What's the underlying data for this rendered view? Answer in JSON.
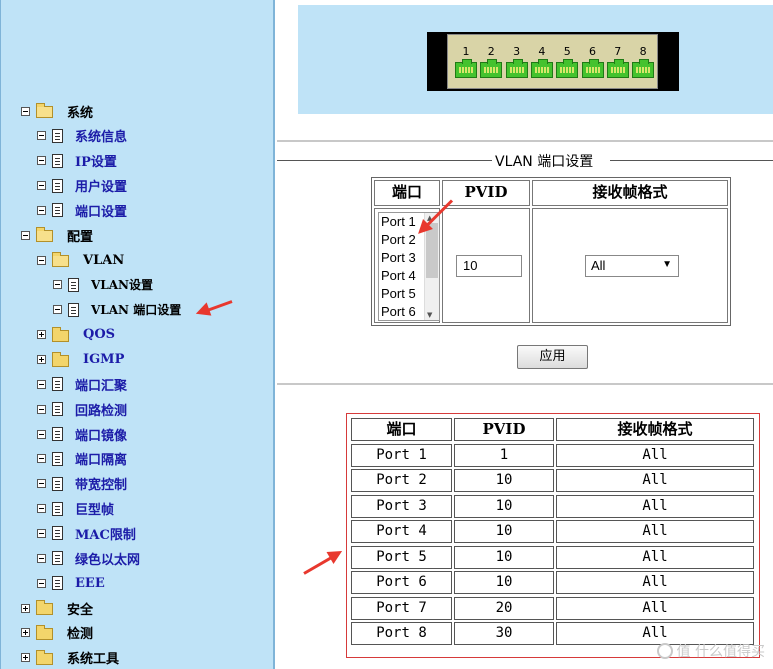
{
  "sidebar": {
    "items": [
      {
        "label": "系统",
        "icon": "folder-open-icon",
        "toggle": "minus"
      },
      {
        "label": "系统信息",
        "icon": "page-icon",
        "toggle": "minus"
      },
      {
        "label": "IP设置",
        "icon": "page-icon",
        "toggle": "minus"
      },
      {
        "label": "用户设置",
        "icon": "page-icon",
        "toggle": "minus"
      },
      {
        "label": "端口设置",
        "icon": "page-icon",
        "toggle": "minus"
      },
      {
        "label": "配置",
        "icon": "folder-open-icon",
        "toggle": "minus"
      },
      {
        "label": "VLAN",
        "icon": "folder-open-icon",
        "toggle": "minus"
      },
      {
        "label": "VLAN设置",
        "icon": "page-icon",
        "toggle": "minus"
      },
      {
        "label": "VLAN 端口设置",
        "icon": "page-icon",
        "toggle": "minus"
      },
      {
        "label": "QOS",
        "icon": "folder-icon",
        "toggle": "plus"
      },
      {
        "label": "IGMP",
        "icon": "folder-icon",
        "toggle": "plus"
      },
      {
        "label": "端口汇聚",
        "icon": "page-icon",
        "toggle": "minus"
      },
      {
        "label": "回路检测",
        "icon": "page-icon",
        "toggle": "minus"
      },
      {
        "label": "端口镜像",
        "icon": "page-icon",
        "toggle": "minus"
      },
      {
        "label": "端口隔离",
        "icon": "page-icon",
        "toggle": "minus"
      },
      {
        "label": "带宽控制",
        "icon": "page-icon",
        "toggle": "minus"
      },
      {
        "label": "巨型帧",
        "icon": "page-icon",
        "toggle": "minus"
      },
      {
        "label": "MAC限制",
        "icon": "page-icon",
        "toggle": "minus"
      },
      {
        "label": "绿色以太网",
        "icon": "page-icon",
        "toggle": "minus"
      },
      {
        "label": "EEE",
        "icon": "page-icon",
        "toggle": "minus"
      },
      {
        "label": "安全",
        "icon": "folder-icon",
        "toggle": "plus"
      },
      {
        "label": "检测",
        "icon": "folder-icon",
        "toggle": "plus"
      },
      {
        "label": "系统工具",
        "icon": "folder-icon",
        "toggle": "plus"
      }
    ]
  },
  "switch_panel": {
    "ports": [
      "1",
      "2",
      "3",
      "4",
      "5",
      "6",
      "7",
      "8"
    ]
  },
  "vlan_port_config": {
    "title": "VLAN 端口设置",
    "headers": {
      "port": "端口",
      "pvid": "PVID",
      "frame": "接收帧格式"
    },
    "port_options": [
      "Port 1",
      "Port 2",
      "Port 3",
      "Port 4",
      "Port 5",
      "Port 6"
    ],
    "pvid_value": "10",
    "frame_value": "All",
    "apply_label": "应用"
  },
  "result_table": {
    "headers": [
      "端口",
      "PVID",
      "接收帧格式"
    ],
    "rows": [
      [
        "Port 1",
        "1",
        "All"
      ],
      [
        "Port 2",
        "10",
        "All"
      ],
      [
        "Port 3",
        "10",
        "All"
      ],
      [
        "Port 4",
        "10",
        "All"
      ],
      [
        "Port 5",
        "10",
        "All"
      ],
      [
        "Port 6",
        "10",
        "All"
      ],
      [
        "Port 7",
        "20",
        "All"
      ],
      [
        "Port 8",
        "30",
        "All"
      ]
    ]
  },
  "colors": {
    "sidebar_bg": "#bfe3f7",
    "link": "#1c1ca8",
    "port_green": "#44c22e",
    "annotation_red": "#e8382e"
  },
  "watermark": "值 什么值得买"
}
